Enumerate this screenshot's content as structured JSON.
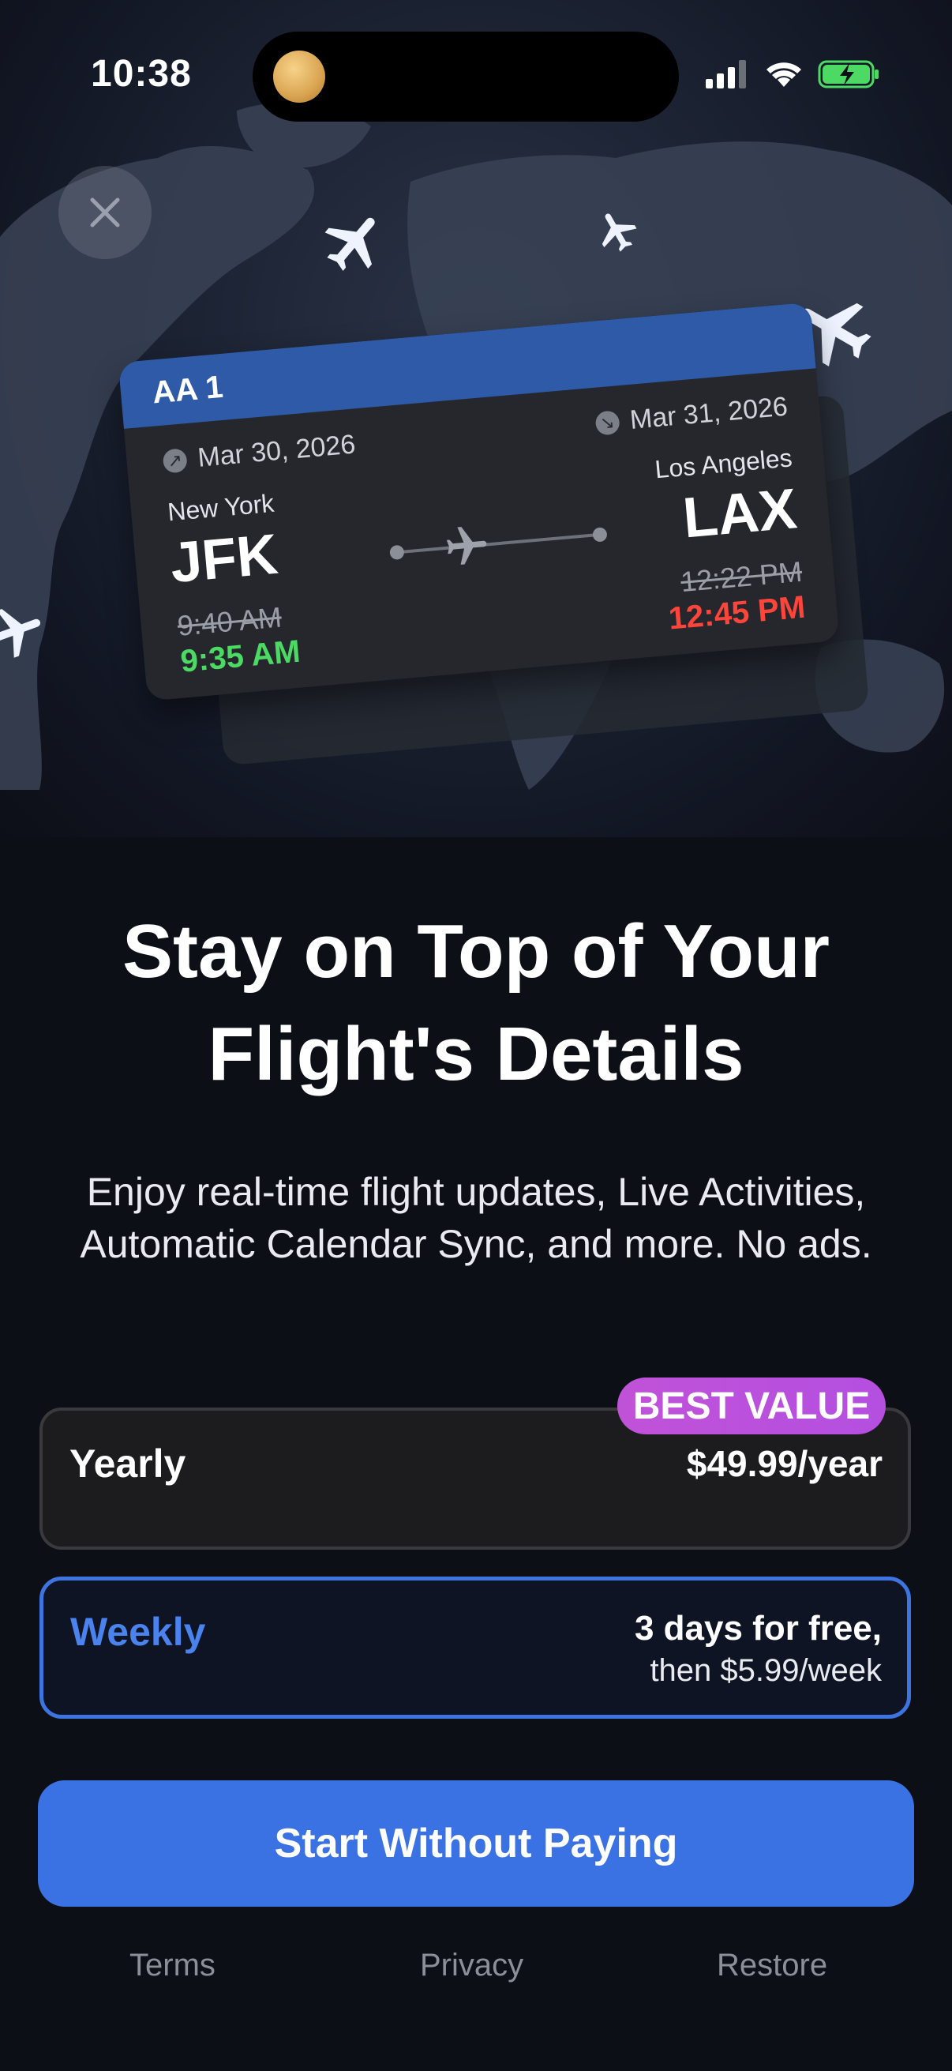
{
  "status_bar": {
    "time": "10:38"
  },
  "ticket": {
    "flight": "AA 1",
    "departure": {
      "date": "Mar 30, 2026",
      "city": "New York",
      "code": "JFK",
      "scheduled": "9:40 AM",
      "actual": "9:35 AM"
    },
    "arrival": {
      "date": "Mar 31, 2026",
      "city": "Los Angeles",
      "code": "LAX",
      "scheduled": "12:22 PM",
      "actual": "12:45 PM"
    }
  },
  "headline": {
    "line1": "Stay on Top of Your",
    "line2": "Flight's Details"
  },
  "subtitle": {
    "line1": "Enjoy real-time flight updates, Live Activities,",
    "line2": "Automatic Calendar Sync, and more. No ads."
  },
  "plans": {
    "badge": "BEST VALUE",
    "yearly": {
      "name": "Yearly",
      "price": "$49.99/year"
    },
    "weekly": {
      "name": "Weekly",
      "trial": "3 days for free,",
      "then": "then $5.99/week"
    }
  },
  "cta_label": "Start Without Paying",
  "footer": {
    "terms": "Terms",
    "privacy": "Privacy",
    "restore": "Restore"
  },
  "colors": {
    "accent": "#3b72e3",
    "badge": "#b44fe0",
    "early": "#4cd964",
    "late": "#ff453a"
  }
}
